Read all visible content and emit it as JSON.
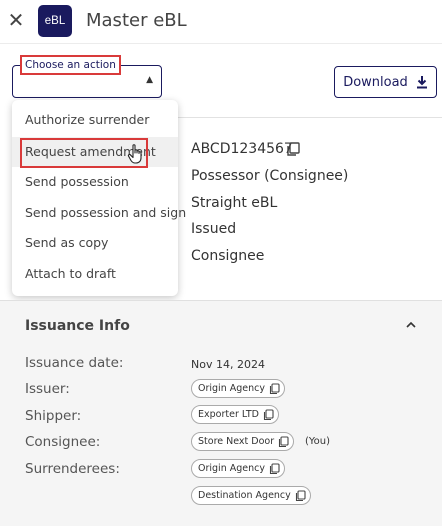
{
  "header": {
    "close_glyph": "✕",
    "app_badge": "eBL",
    "title": "Master eBL"
  },
  "action_select": {
    "label": "Choose an action",
    "caret_glyph": "▲"
  },
  "download": {
    "label": "Download",
    "icon": "download-icon"
  },
  "details": {
    "document_number": "ABCD1234567",
    "possessor": "Possessor (Consignee)",
    "type": "Straight eBL",
    "status": "Issued",
    "role": "Consignee"
  },
  "menu": {
    "items": [
      {
        "label": "Authorize surrender"
      },
      {
        "label": "Request amendment"
      },
      {
        "label": "Send possession"
      },
      {
        "label": "Send possession and sign"
      },
      {
        "label": "Send as copy"
      },
      {
        "label": "Attach to draft"
      }
    ],
    "hovered_index": 1
  },
  "issuance": {
    "title": "Issuance Info",
    "rows": {
      "date_label": "Issuance date:",
      "date_value": "Nov 14, 2024",
      "issuer_label": "Issuer:",
      "issuer_value": "Origin Agency",
      "shipper_label": "Shipper:",
      "shipper_value": "Exporter LTD",
      "consignee_label": "Consignee:",
      "consignee_value": "Store Next Door",
      "consignee_suffix": "(You)",
      "surrenderees_label": "Surrenderees:",
      "surrenderees_values": [
        "Origin Agency",
        "Destination Agency"
      ]
    }
  },
  "colors": {
    "brand_navy": "#1a1a5e",
    "highlight_red": "#d93a3a",
    "section_bg": "#f5f5f5"
  }
}
